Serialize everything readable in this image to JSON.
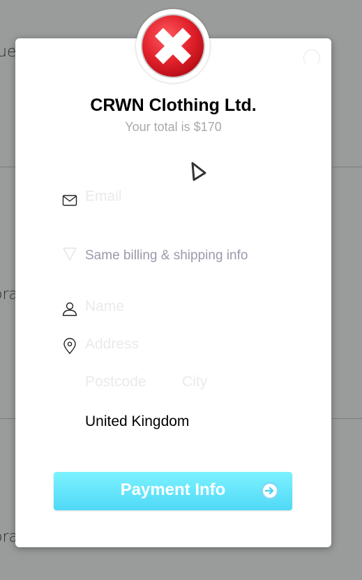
{
  "background": {
    "fragment_top": "ue",
    "fragment_mid": "ora",
    "fragment_bottom": "ora"
  },
  "modal": {
    "logo_icon": "red-x-icon",
    "title": "CRWN Clothing Ltd.",
    "subtitle": "Your total is $170",
    "email": {
      "icon": "envelope-icon",
      "placeholder": "Email",
      "value": ""
    },
    "same_info": {
      "icon": "checkmark-icon",
      "label": "Same billing & shipping info",
      "checked": false
    },
    "name": {
      "icon": "person-icon",
      "placeholder": "Name",
      "value": ""
    },
    "address": {
      "icon": "location-pin-icon",
      "placeholder": "Address",
      "value": ""
    },
    "postcode": {
      "placeholder": "Postcode",
      "value": ""
    },
    "city": {
      "placeholder": "City",
      "value": ""
    },
    "country": "United Kingdom",
    "payment_button": {
      "label": "Payment Info",
      "icon": "arrow-right-circle-icon"
    }
  },
  "colors": {
    "overlay": "#9a9b9b",
    "accent": "#5ee4fb",
    "logo_red": "#e0202a"
  }
}
